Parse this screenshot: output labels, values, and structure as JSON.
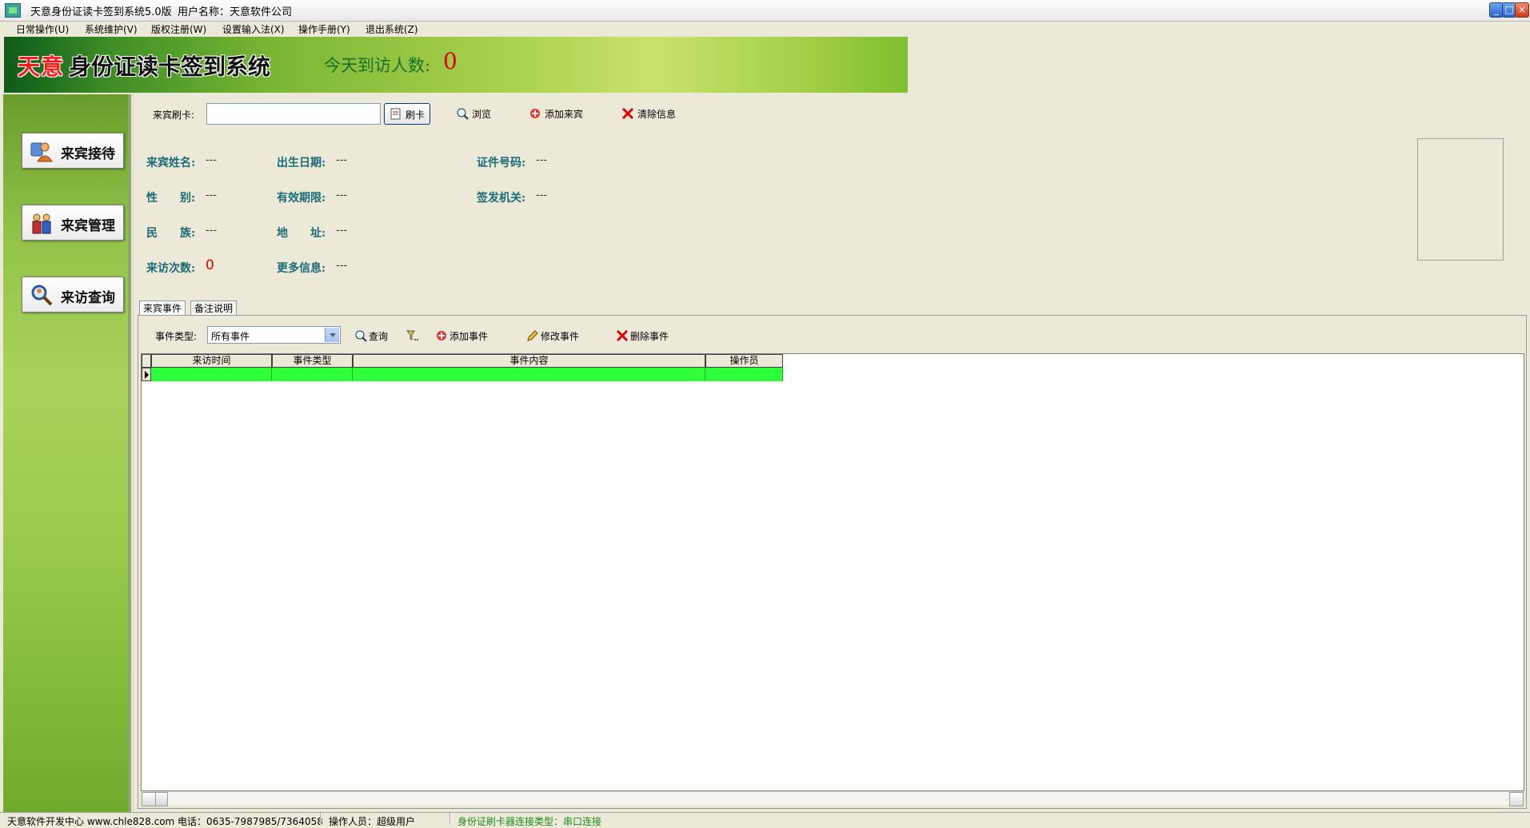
{
  "window": {
    "title": "天意身份证读卡签到系统5.0版",
    "user_label": "用户名称：天意软件公司",
    "controls": {
      "minimize": "_",
      "maximize": "□",
      "close": "×"
    }
  },
  "menu": [
    "日常操作(U)",
    "系统维护(V)",
    "版权注册(W)",
    "设置输入法(X)",
    "操作手册(Y)",
    "退出系统(Z)"
  ],
  "banner": {
    "brand": "天意",
    "system_name": "身份证读卡签到系统",
    "visitor_label": "今天到访人数:",
    "visitor_count": "0"
  },
  "sidebar": [
    {
      "label": "来宾接待",
      "icon": "reception-icon"
    },
    {
      "label": "来宾管理",
      "icon": "guest-management-icon"
    },
    {
      "label": "来访查询",
      "icon": "search-query-icon"
    }
  ],
  "toolbar": {
    "card_label": "来宾刷卡:",
    "card_value": "",
    "swipe": "刷卡",
    "browse": "浏览",
    "add_guest": "添加来宾",
    "clear_info": "清除信息"
  },
  "info": {
    "name_label": "来宾姓名:",
    "name_value": "---",
    "birth_label": "出生日期:",
    "birth_value": "---",
    "id_label": "证件号码:",
    "id_value": "---",
    "gender_label": "性　　别:",
    "gender_value": "---",
    "valid_label": "有效期限:",
    "valid_value": "---",
    "authority_label": "签发机关:",
    "authority_value": "---",
    "ethnic_label": "民　　族:",
    "ethnic_value": "---",
    "address_label": "地　　址:",
    "address_value": "---",
    "visits_label": "来访次数:",
    "visits_value": "0",
    "more_label": "更多信息:",
    "more_value": "---"
  },
  "tabs": [
    "来宾事件",
    "备注说明"
  ],
  "events": {
    "type_label": "事件类型:",
    "type_value": "所有事件",
    "query": "查询",
    "add": "添加事件",
    "edit": "修改事件",
    "delete": "删除事件"
  },
  "grid": {
    "columns": [
      "来访时间",
      "事件类型",
      "事件内容",
      "操作员"
    ],
    "rows": [
      [
        "",
        "",
        "",
        ""
      ]
    ],
    "highlight_color": "#2eff3a"
  },
  "status": {
    "company": "天意软件开发中心 www.chle828.com 电话：0635-7987985/7364058",
    "operator": "操作人员：超级用户",
    "reader": "身份证刷卡器连接类型：串口连接"
  },
  "colors": {
    "accent_red": "#e00000",
    "label_teal": "#1a6b75",
    "banner_green": "#7ab734"
  }
}
